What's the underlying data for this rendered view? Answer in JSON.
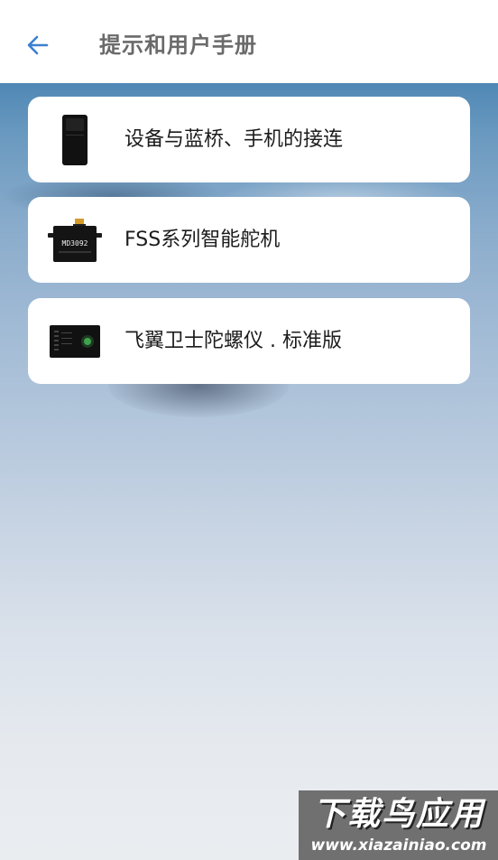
{
  "header": {
    "title": "提示和用户手册",
    "back_icon": "arrow-left-icon",
    "accent_color": "#3b7fd0"
  },
  "items": [
    {
      "label": "设备与蓝桥、手机的接连",
      "icon": "bluetooth-bridge-device-icon"
    },
    {
      "label": "FSS系列智能舵机",
      "icon": "servo-motor-icon",
      "device_text": "MD3092"
    },
    {
      "label": "飞翼卫士陀螺仪 . 标准版",
      "icon": "gyroscope-board-icon"
    }
  ],
  "watermark": {
    "title": "下载鸟应用",
    "url": "www.xiazainiao.com"
  }
}
